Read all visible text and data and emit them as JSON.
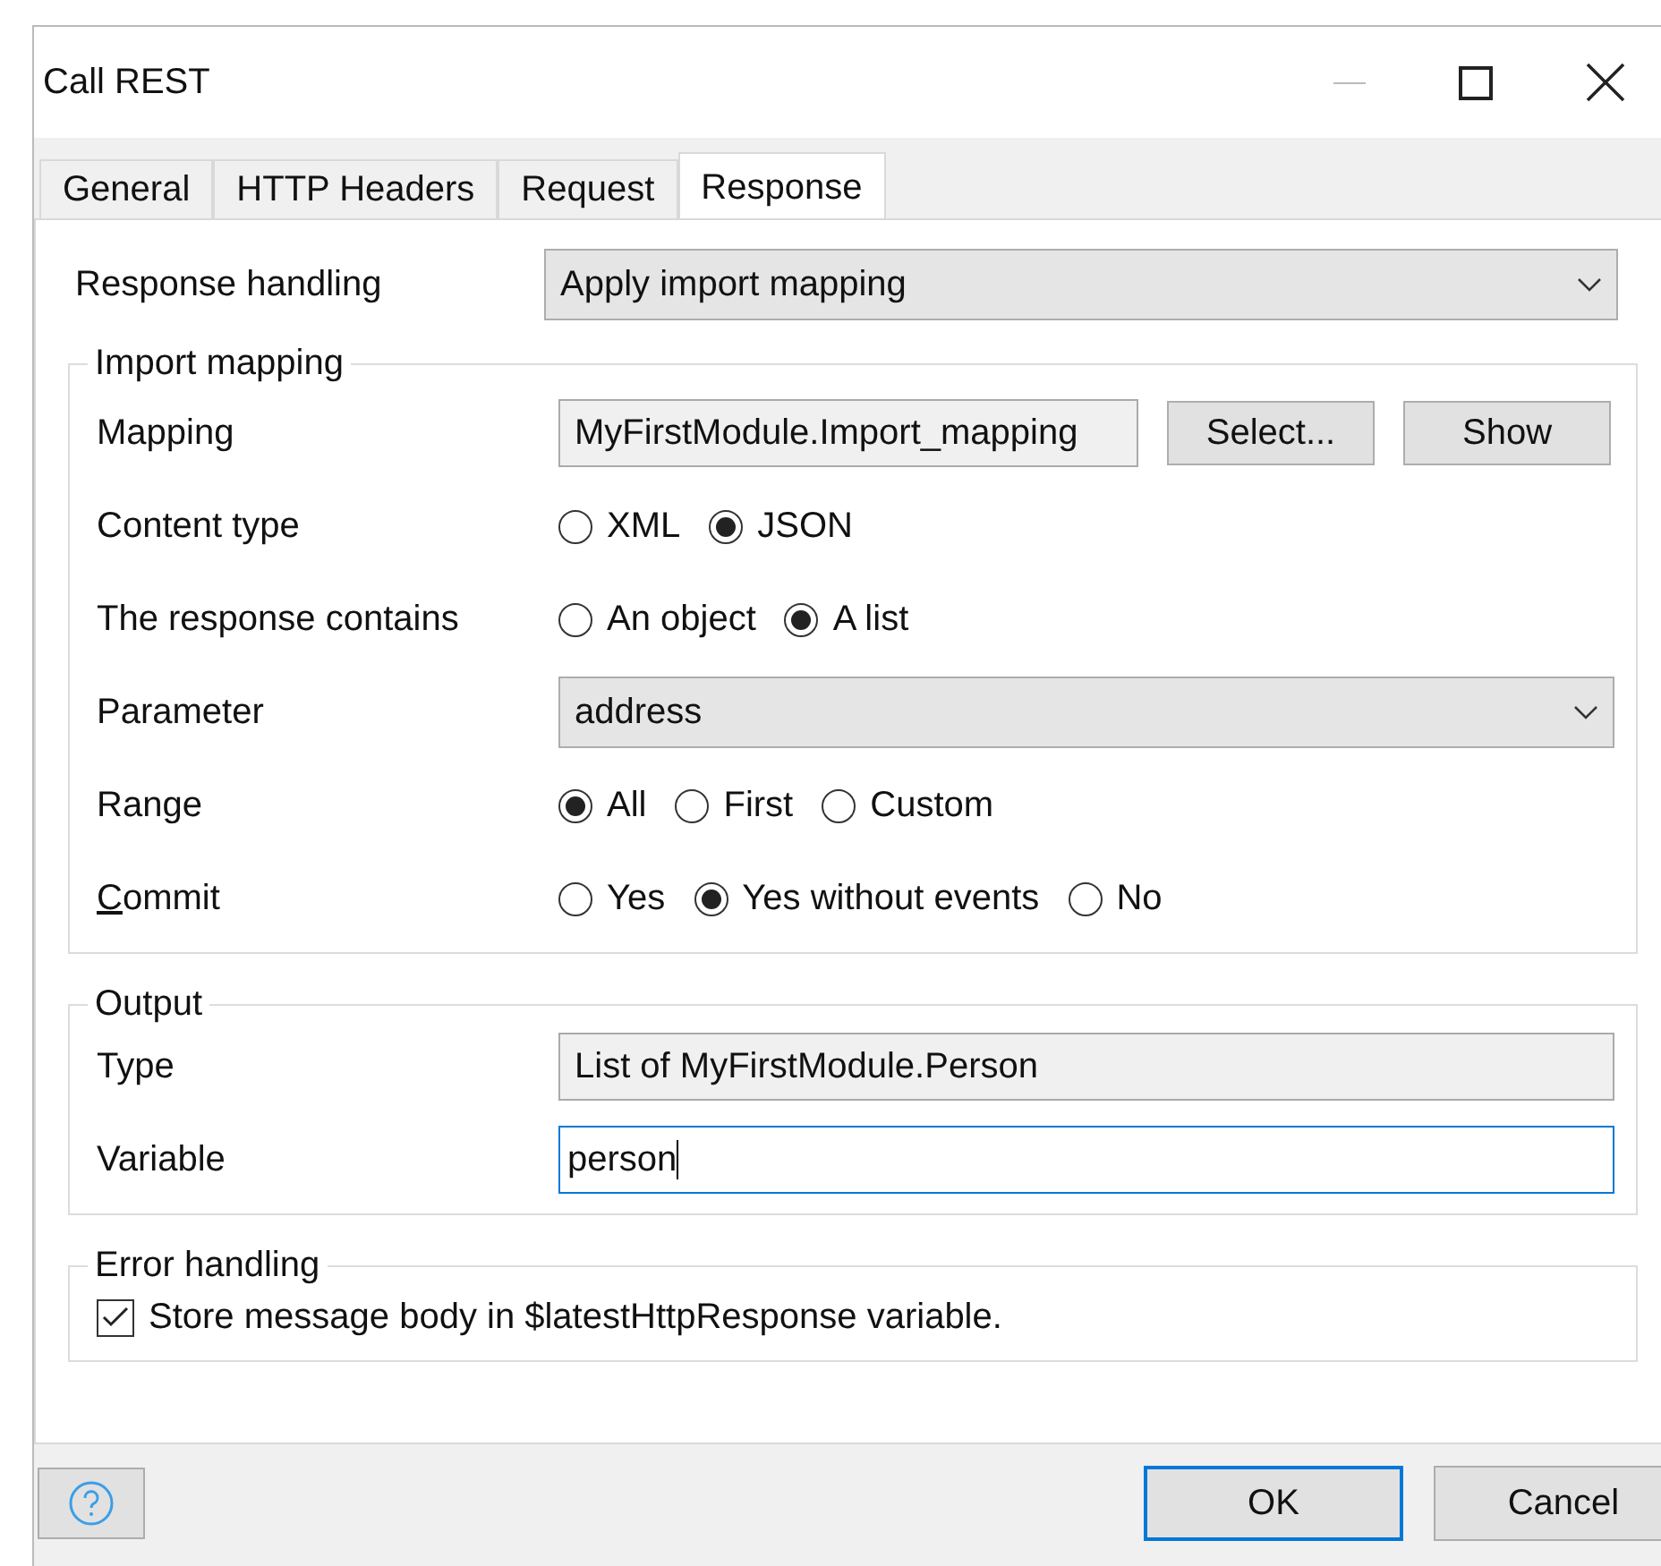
{
  "window": {
    "title": "Call REST"
  },
  "tabs": [
    {
      "label": "General",
      "selected": false
    },
    {
      "label": "HTTP Headers",
      "selected": false
    },
    {
      "label": "Request",
      "selected": false
    },
    {
      "label": "Response",
      "selected": true
    }
  ],
  "response_handling": {
    "label": "Response handling",
    "value": "Apply import mapping"
  },
  "groups": [
    {
      "title": "Import mapping",
      "rows": [
        {
          "kind": "field_buttons",
          "label": "Mapping",
          "value": "MyFirstModule.Import_mapping",
          "buttons": [
            "Select...",
            "Show"
          ]
        },
        {
          "kind": "radio",
          "label": "Content type",
          "options": [
            {
              "label": "XML",
              "selected": false
            },
            {
              "label": "JSON",
              "selected": true
            }
          ]
        },
        {
          "kind": "radio",
          "label": "The response contains",
          "options": [
            {
              "label": "An object",
              "selected": false
            },
            {
              "label": "A list",
              "selected": true
            }
          ]
        },
        {
          "kind": "dropdown",
          "label": "Parameter",
          "value": "address"
        },
        {
          "kind": "radio",
          "label": "Range",
          "options": [
            {
              "label": "All",
              "selected": true
            },
            {
              "label": "First",
              "selected": false
            },
            {
              "label": "Custom",
              "selected": false
            }
          ]
        },
        {
          "kind": "radio",
          "label": "Commit",
          "mnemonic_first": true,
          "options": [
            {
              "label": "Yes",
              "selected": false
            },
            {
              "label": "Yes without events",
              "selected": true
            },
            {
              "label": "No",
              "selected": false
            }
          ]
        }
      ]
    },
    {
      "title": "Output",
      "rows": [
        {
          "kind": "readonly",
          "label": "Type",
          "value": "List of MyFirstModule.Person"
        },
        {
          "kind": "input",
          "label": "Variable",
          "value": "person",
          "focused": true
        }
      ]
    },
    {
      "title": "Error handling",
      "rows": [
        {
          "kind": "checkbox",
          "label": "Store message body in $latestHttpResponse variable.",
          "checked": true
        }
      ]
    }
  ],
  "buttons": [
    {
      "label": "OK",
      "default": true
    },
    {
      "label": "Cancel",
      "default": false
    }
  ]
}
